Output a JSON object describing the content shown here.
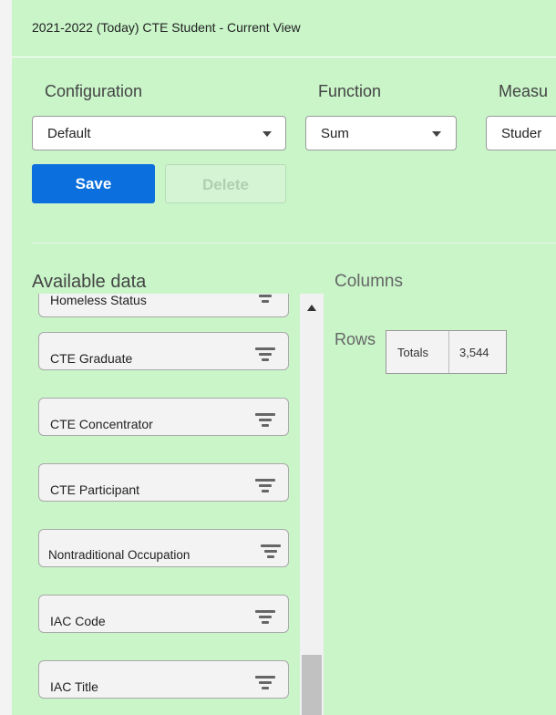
{
  "header": {
    "title": "2021-2022 (Today) CTE Student - Current View"
  },
  "config": {
    "configuration_label": "Configuration",
    "configuration_value": "Default",
    "function_label": "Function",
    "function_value": "Sum",
    "measure_label": "Measu",
    "measure_value": "Studer"
  },
  "buttons": {
    "save": "Save",
    "delete": "Delete"
  },
  "available": {
    "title": "Available data",
    "items": [
      "Homeless Status",
      "CTE Graduate",
      "CTE Concentrator",
      "CTE Participant",
      "Nontraditional Occupation",
      "IAC Code",
      "IAC Title"
    ]
  },
  "pivot": {
    "columns_label": "Columns",
    "rows_label": "Rows",
    "totals_label": "Totals",
    "totals_value": "3,544"
  },
  "colors": {
    "background": "#c9f5c9",
    "primary": "#0b6fde"
  }
}
